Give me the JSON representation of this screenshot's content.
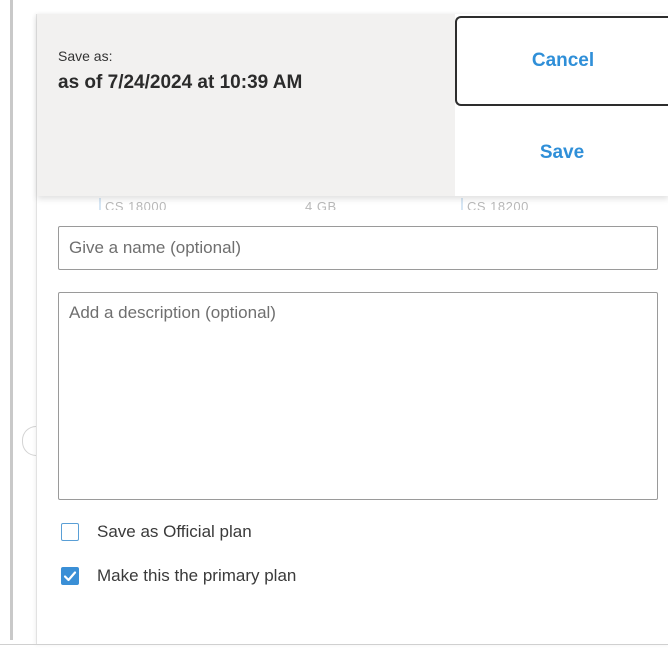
{
  "header": {
    "save_as_label": "Save as:",
    "save_as_value": "as of 7/24/2024 at 10:39 AM"
  },
  "actions": {
    "cancel_label": "Cancel",
    "save_label": "Save"
  },
  "background_peek": {
    "items": [
      "CS 18000",
      "4 GB",
      "CS 18200"
    ]
  },
  "form": {
    "name_placeholder": "Give a name (optional)",
    "name_value": "",
    "description_placeholder": "Add a description (optional)",
    "description_value": "",
    "official_plan": {
      "label": "Save as Official plan",
      "checked": false
    },
    "primary_plan": {
      "label": "Make this the primary plan",
      "checked": true
    }
  },
  "colors": {
    "accent": "#2f8fd8",
    "header_bg": "#f2f1f0",
    "checkbox_checked": "#3a8fd6"
  }
}
